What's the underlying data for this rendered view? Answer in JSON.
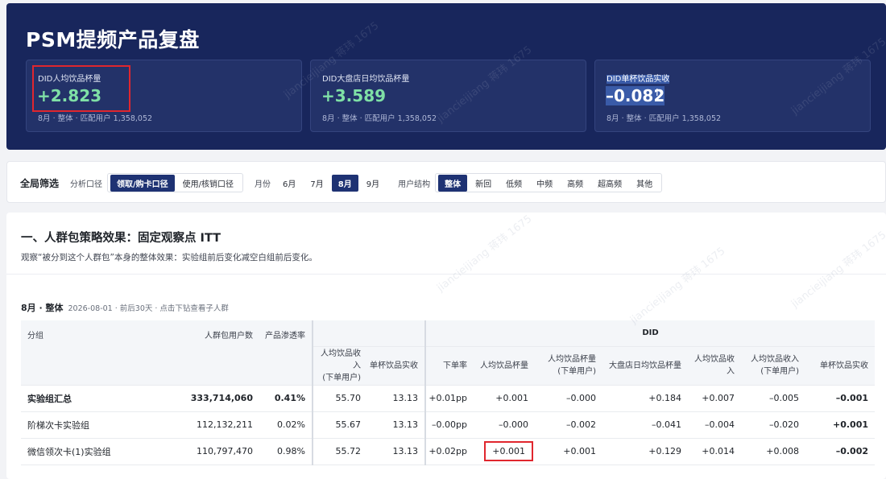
{
  "header": {
    "title": "PSM提频产品复盘",
    "cards": [
      {
        "label": "DID人均饮品杯量",
        "value": "+2.823",
        "sub": "8月 · 整体 · 匹配用户 1,358,052"
      },
      {
        "label": "DID大盘店日均饮品杯量",
        "value": "+3.589",
        "sub": "8月 · 整体 · 匹配用户 1,358,052"
      },
      {
        "label": "DID单杯饮品实收",
        "value": "–0.082",
        "sub": "8月 · 整体 · 匹配用户 1,358,052"
      }
    ]
  },
  "filters": {
    "title": "全局筛选",
    "analysis_label": "分析口径",
    "analysis_options": [
      "领取/购卡口径",
      "使用/核销口径"
    ],
    "month_label": "月份",
    "month_options": [
      "6月",
      "7月",
      "8月",
      "9月"
    ],
    "structure_label": "用户结构",
    "structure_options": [
      "整体",
      "新回",
      "低频",
      "中频",
      "高频",
      "超高频",
      "其他"
    ]
  },
  "section": {
    "title": "一、人群包策略效果：固定观察点 ITT",
    "desc": "观察“被分到这个人群包”本身的整体效果：实验组前后变化减空白组前后变化。",
    "sub_title": "8月 · 整体",
    "sub_meta": "2026-08-01 · 前后30天 · 点击下钻查看子人群"
  },
  "table": {
    "headers": {
      "group": "分组",
      "users": "人群包用户数",
      "penetration": "产品渗透率",
      "did": "DID",
      "left_cols": [
        "人均饮品收入\n(下单用户)",
        "单杯饮品实收"
      ],
      "did_cols": [
        "下单率",
        "人均饮品杯量",
        "人均饮品杯量\n(下单用户)",
        "大盘店日均饮品杯量",
        "人均饮品收入",
        "人均饮品收入\n(下单用户)",
        "单杯饮品实收"
      ]
    },
    "rows": [
      {
        "name": "实验组汇总",
        "users": "333,714,060",
        "penetration": "0.41%",
        "rev": "55.70",
        "unit": "13.13",
        "d1": "+0.01pp",
        "d2": "+0.001",
        "d3": "–0.000",
        "d4": "+0.184",
        "d5": "+0.007",
        "d6": "–0.005",
        "d7": "–0.001"
      },
      {
        "name": "阶梯次卡实验组",
        "users": "112,132,211",
        "penetration": "0.02%",
        "rev": "55.67",
        "unit": "13.13",
        "d1": "–0.00pp",
        "d2": "–0.000",
        "d3": "–0.002",
        "d4": "–0.041",
        "d5": "–0.004",
        "d6": "–0.020",
        "d7": "+0.001"
      },
      {
        "name": "微信领次卡(1)实验组",
        "users": "110,797,470",
        "penetration": "0.98%",
        "rev": "55.72",
        "unit": "13.13",
        "d1": "+0.02pp",
        "d2": "+0.001",
        "d3": "+0.001",
        "d4": "+0.129",
        "d5": "+0.014",
        "d6": "+0.008",
        "d7": "–0.002"
      }
    ]
  },
  "watermark": "jiancieijiang 蒋玮 1675",
  "colors": {
    "header_bg": "#18265c",
    "accent": "#1e3273",
    "positive": "#7fe0a6",
    "highlight": "#e0262e"
  }
}
